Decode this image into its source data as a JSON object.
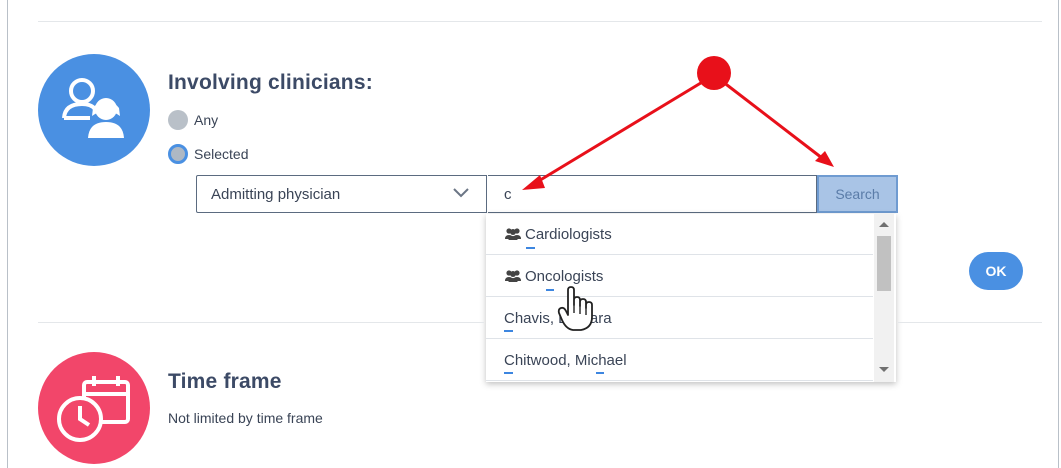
{
  "clinicians": {
    "title": "Involving clinicians:",
    "options": [
      {
        "label": "Any",
        "selected": false
      },
      {
        "label": "Selected",
        "selected": true
      }
    ],
    "role_select": {
      "value": "Admitting physician"
    },
    "search_input": {
      "value": "c"
    },
    "search_button": "Search",
    "ok_button": "OK",
    "suggestions": [
      {
        "label": "Cardiologists",
        "group": true
      },
      {
        "label": "Oncologists",
        "group": true
      },
      {
        "label": "Chavis, Barbara",
        "group": false
      },
      {
        "label": "Chitwood, Michael",
        "group": false
      }
    ]
  },
  "timeframe": {
    "title": "Time frame",
    "description": "Not limited by time frame"
  },
  "colors": {
    "accent_blue": "#4a90e2",
    "timeframe_red": "#f2466a",
    "annotation_red": "#e8101a"
  },
  "icons": [
    "clinicians-icon",
    "time-frame-icon",
    "group-icon",
    "chevron-down-icon",
    "hand-cursor-icon"
  ]
}
